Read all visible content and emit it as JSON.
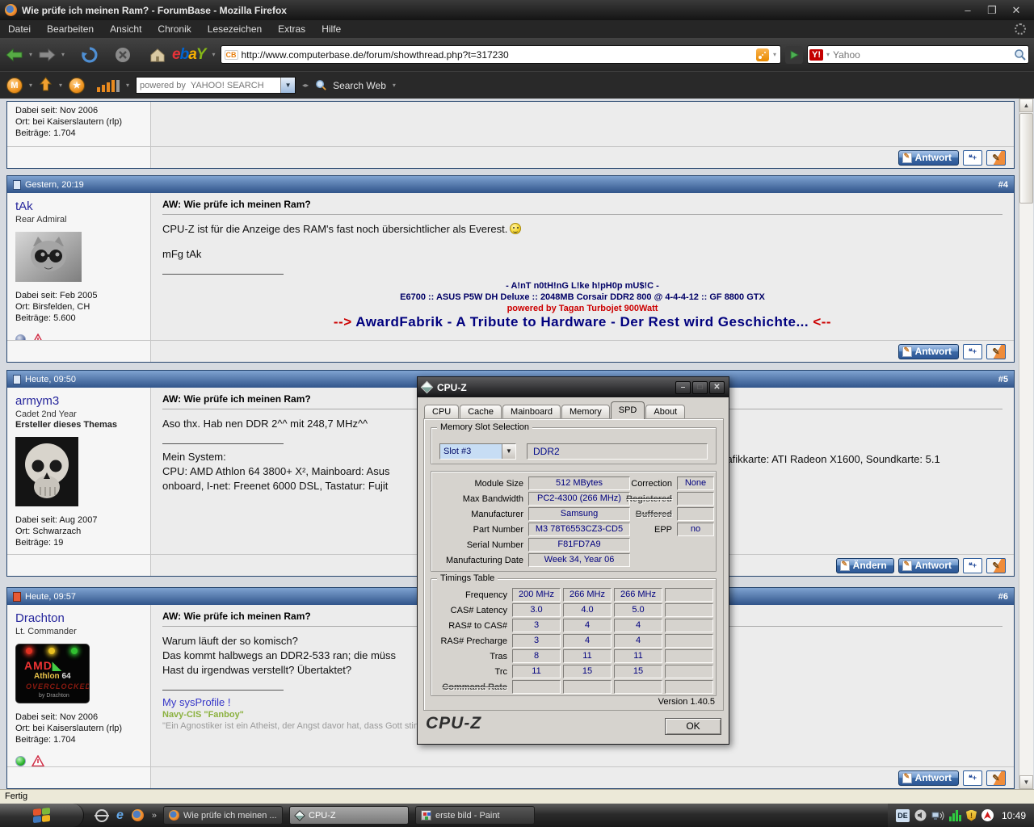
{
  "browser": {
    "title": "Wie prüfe ich meinen Ram? - ForumBase - Mozilla Firefox",
    "menu": [
      "Datei",
      "Bearbeiten",
      "Ansicht",
      "Chronik",
      "Lesezeichen",
      "Extras",
      "Hilfe"
    ],
    "url": "http://www.computerbase.de/forum/showthread.php?t=317230",
    "url_favicon": "CB",
    "ebay": {
      "l1": "e",
      "l2": "b",
      "l3": "a",
      "l4": "Y"
    },
    "yahoo_badge": "Y!",
    "yahoo_placeholder": "Yahoo",
    "status": "Fertig"
  },
  "yahoo_toolbar": {
    "m_icon": "M",
    "search_placeholder": "powered by  YAHOO! SEARCH",
    "search_web": "Search Web"
  },
  "forum": {
    "reply_button": "Antwort",
    "edit_button": "Ändern",
    "posts": [
      {
        "info": [
          "Dabei seit: Nov 2006",
          "Ort: bei Kaiserslautern (rlp)",
          "Beiträge: 1.704"
        ]
      },
      {
        "number": "#4",
        "date": "Gestern, 20:19",
        "user": "tAk",
        "rank": "Rear Admiral",
        "title": "AW: Wie prüfe ich meinen Ram?",
        "line1": "CPU-Z ist für die Anzeige des RAM's fast noch übersichtlicher als Everest.",
        "line2": "mFg tAk",
        "sig1": "- A!nT n0tH!nG L!ke h!pH0p mU$!C -",
        "sig2": "E6700 :: ASUS P5W DH Deluxe :: 2048MB Corsair DDR2 800 @ 4-4-4-12 :: GF 8800 GTX",
        "sig3": "powered by Tagan Turbojet 900Watt",
        "sig4a": "-->",
        "sig4b": " AwardFabrik - A Tribute to Hardware - Der Rest wird Geschichte... ",
        "sig4c": "<--",
        "info": [
          "Dabei seit: Feb 2005",
          "Ort: Birsfelden, CH",
          "Beiträge: 5.600"
        ]
      },
      {
        "number": "#5",
        "date": "Heute, 09:50",
        "user": "armym3",
        "rank": "Cadet 2nd Year",
        "starter": "Ersteller dieses Themas",
        "title": "AW: Wie prüfe ich meinen Ram?",
        "line1": "Aso thx. Hab nen DDR 2^^ mit 248,7 MHz^^",
        "sys_head": "Mein System:",
        "sys1": "CPU: AMD Athlon 64 3800+ X², Mainboard: Asus",
        "sys1_right": "Grafikkarte: ATI Radeon X1600, Soundkarte: 5.1",
        "sys2": "onboard, I-net: Freenet 6000 DSL, Tastatur: Fujit",
        "sys2_right": ")",
        "info": [
          "Dabei seit: Aug 2007",
          "Ort: Schwarzach",
          "Beiträge: 19"
        ]
      },
      {
        "number": "#6",
        "date": "Heute, 09:57",
        "user": "Drachton",
        "rank": "Lt. Commander",
        "title": "AW: Wie prüfe ich meinen Ram?",
        "line1": "Warum läuft der so komisch?",
        "line2": "Das kommt halbwegs an DDR2-533 ran; die müss",
        "line3": "Hast du irgendwas verstellt? Übertaktet?",
        "sig_link": "My sysProfile !",
        "sig_green": "Navy-CIS \"Fanboy\"",
        "sig_gray": "\"Ein Agnostiker ist ein Atheist, der Angst davor hat, dass Gott stink",
        "avatar": {
          "l1": "AMD",
          "l2": "Athlon",
          "l2b": "64",
          "l3": "OVERCLOCKED",
          "l4": "by Drachton"
        },
        "info": [
          "Dabei seit: Nov 2006",
          "Ort: bei Kaiserslautern (rlp)",
          "Beiträge: 1.704"
        ]
      }
    ]
  },
  "cpuz": {
    "title": "CPU-Z",
    "tabs": [
      "CPU",
      "Cache",
      "Mainboard",
      "Memory",
      "SPD",
      "About"
    ],
    "groups": {
      "slot": "Memory Slot Selection",
      "timings": "Timings Table"
    },
    "slot_value": "Slot #3",
    "memory_type": "DDR2",
    "fields": {
      "module_size_label": "Module Size",
      "module_size": "512 MBytes",
      "max_bandwidth_label": "Max Bandwidth",
      "max_bandwidth": "PC2-4300 (266 MHz)",
      "manufacturer_label": "Manufacturer",
      "manufacturer": "Samsung",
      "part_number_label": "Part Number",
      "part_number": "M3 78T6553CZ3-CD5",
      "serial_number_label": "Serial Number",
      "serial_number": "F81FD7A9",
      "manufacturing_date_label": "Manufacturing Date",
      "manufacturing_date": "Week 34, Year 06",
      "correction_label": "Correction",
      "correction": "None",
      "registered_label": "Registered",
      "buffered_label": "Buffered",
      "epp_label": "EPP",
      "epp": "no"
    },
    "timings": {
      "rows": [
        {
          "label": "Frequency",
          "v1": "200 MHz",
          "v2": "266 MHz",
          "v3": "266 MHz"
        },
        {
          "label": "CAS# Latency",
          "v1": "3.0",
          "v2": "4.0",
          "v3": "5.0"
        },
        {
          "label": "RAS# to CAS#",
          "v1": "3",
          "v2": "4",
          "v3": "4"
        },
        {
          "label": "RAS# Precharge",
          "v1": "3",
          "v2": "4",
          "v3": "4"
        },
        {
          "label": "Tras",
          "v1": "8",
          "v2": "11",
          "v3": "11"
        },
        {
          "label": "Trc",
          "v1": "11",
          "v2": "15",
          "v3": "15"
        },
        {
          "label": "Command Rate"
        }
      ]
    },
    "version": "Version 1.40.5",
    "logo": "CPU-Z",
    "ok": "OK"
  },
  "taskbar": {
    "tasks": [
      "Wie prüfe ich meinen ...",
      "CPU-Z",
      "erste bild - Paint"
    ],
    "lang": "DE",
    "clock": "10:49"
  }
}
